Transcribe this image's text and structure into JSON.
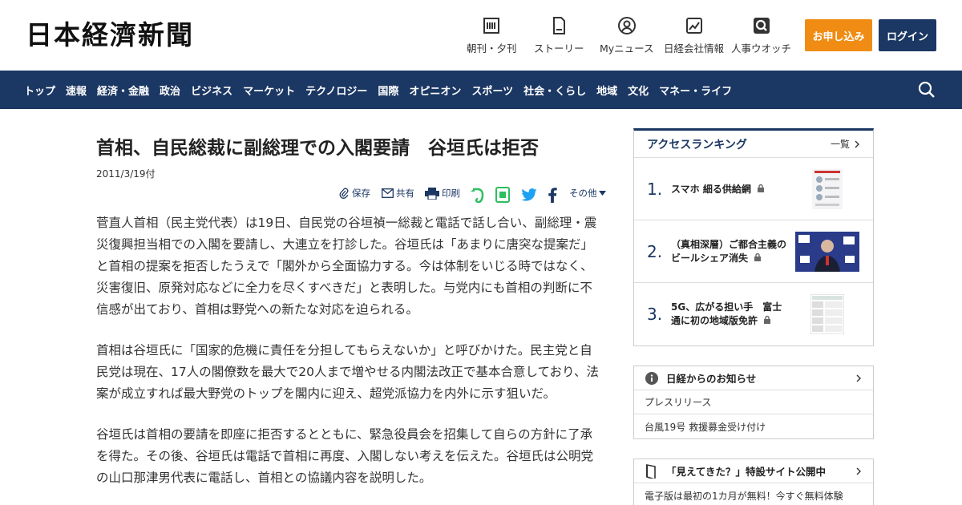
{
  "header": {
    "logo": "日本経濟新聞",
    "nav": [
      {
        "label": "朝刊・夕刊",
        "icon": "newspaper-icon"
      },
      {
        "label": "ストーリー",
        "icon": "document-icon"
      },
      {
        "label": "Myニュース",
        "icon": "user-icon"
      },
      {
        "label": "日経会社情報",
        "icon": "company-chart-icon"
      },
      {
        "label": "人事ウオッチ",
        "icon": "search-person-icon"
      }
    ],
    "subscribe_label": "お申し込み",
    "login_label": "ログイン"
  },
  "navbar": {
    "items": [
      "トップ",
      "速報",
      "経済・金融",
      "政治",
      "ビジネス",
      "マーケット",
      "テクノロジー",
      "国際",
      "オピニオン",
      "スポーツ",
      "社会・くらし",
      "地域",
      "文化",
      "マネー・ライフ"
    ]
  },
  "article": {
    "title": "首相、自民総裁に副総理での入閣要請　谷垣氏は拒否",
    "date": "2011/3/19付",
    "tools": {
      "save": "保存",
      "share": "共有",
      "print": "印刷",
      "more": "その他"
    },
    "paragraphs": [
      "菅直人首相（民主党代表）は19日、自民党の谷垣禎一総裁と電話で話し合い、副総理・震災復興担当相での入閣を要請し、大連立を打診した。谷垣氏は「あまりに唐突な提案だ」と首相の提案を拒否したうえで「閣外から全面協力する。今は体制をいじる時ではなく、災害復旧、原発対応などに全力を尽くすべきだ」と表明した。与党内にも首相の判断に不信感が出ており、首相は野党への新たな対応を迫られる。",
      "首相は谷垣氏に「国家的危機に責任を分担してもらえないか」と呼びかけた。民主党と自民党は現在、17人の閣僚数を最大で20人まで増やせる内閣法改正で基本合意しており、法案が成立すれば最大野党のトップを閣内に迎え、超党派協力を内外に示す狙いだ。",
      "谷垣氏は首相の要請を即座に拒否するとともに、緊急役員会を招集して自らの方針に了承を得た。その後、谷垣氏は電話で首相に再度、入閣しない考えを伝えた。谷垣氏は公明党の山口那津男代表に電話し、首相との協議内容を説明した。"
    ]
  },
  "ranking": {
    "title": "アクセスランキング",
    "all_label": "一覧",
    "items": [
      {
        "rank": "1.",
        "text": "スマホ 細る供給網"
      },
      {
        "rank": "2.",
        "text": "（真相深層）ご都合主義のビールシェア消失"
      },
      {
        "rank": "3.",
        "text": "5G、広がる担い手　富士通に初の地域版免許"
      }
    ]
  },
  "notice": {
    "title": "日経からのお知らせ",
    "rows": [
      "プレスリリース",
      "台風19号 救援募金受け付け"
    ]
  },
  "special": {
    "title": "「見えてきた？」特設サイト公開中",
    "row": "電子版は最初の1カ月が無料！今すぐ無料体験"
  },
  "colors": {
    "navy": "#1b3763",
    "orange": "#f08c14",
    "evernote": "#2dbe60",
    "twitter": "#1da1f2",
    "facebook": "#1b3763"
  }
}
